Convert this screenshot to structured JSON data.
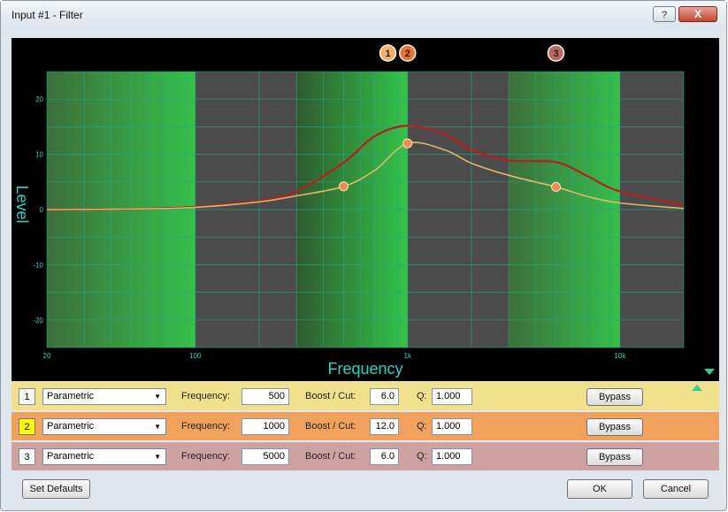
{
  "window": {
    "title": "Input #1 - Filter",
    "help_glyph": "?",
    "close_glyph": "X"
  },
  "graph": {
    "y_label": "Level",
    "x_label": "Frequency",
    "y_ticks": [
      "20",
      "10",
      "0",
      "-10",
      "-20"
    ],
    "x_ticks": [
      "20",
      "100",
      "1k",
      "10k"
    ],
    "markers": [
      "1",
      "2",
      "3"
    ],
    "colors": {
      "band1": "#f5b06f",
      "band2": "#e8733f",
      "band3": "#b46a6a",
      "combined": "#b52020",
      "single": "#e2b765",
      "grid": "#1fa98b",
      "axis_text": "#2dd3c3"
    }
  },
  "chart_data": {
    "type": "line",
    "x_scale": "log",
    "xlim": [
      20,
      20000
    ],
    "ylim": [
      -25,
      25
    ],
    "xlabel": "Frequency",
    "ylabel": "Level",
    "series": [
      {
        "x": [
          20,
          50,
          100,
          200,
          300,
          500,
          700,
          1000,
          1500,
          2000,
          3000,
          5000,
          7000,
          10000,
          20000
        ],
        "values": [
          0,
          0.1,
          0.5,
          1.6,
          3.3,
          8.5,
          13.3,
          15.2,
          13.6,
          10.8,
          8.9,
          8.6,
          6.1,
          3.3,
          0.8
        ]
      },
      {
        "x": [
          20,
          50,
          100,
          200,
          300,
          500,
          700,
          1000,
          1500,
          2000,
          3000,
          5000,
          7000,
          10000,
          20000
        ],
        "values": [
          0,
          0.1,
          0.4,
          1.4,
          2.5,
          4.2,
          7.1,
          12.0,
          10.8,
          8.4,
          6.2,
          4.1,
          2.4,
          1.2,
          0.2
        ]
      }
    ],
    "points": [
      {
        "label": "1",
        "x": 500,
        "y": 4.2
      },
      {
        "label": "2",
        "x": 1000,
        "y": 12.0
      },
      {
        "label": "3",
        "x": 5000,
        "y": 4.1
      }
    ]
  },
  "bands": [
    {
      "number": "1",
      "type": "Parametric",
      "freq_label": "Frequency:",
      "frequency": "500",
      "gain_label": "Boost / Cut:",
      "gain": "6.0",
      "q_label": "Q:",
      "q": "1.000",
      "bypass": "Bypass",
      "color": "#f1e18c",
      "active": false
    },
    {
      "number": "2",
      "type": "Parametric",
      "freq_label": "Frequency:",
      "frequency": "1000",
      "gain_label": "Boost / Cut:",
      "gain": "12.0",
      "q_label": "Q:",
      "q": "1.000",
      "bypass": "Bypass",
      "color": "#f0a25c",
      "active": true
    },
    {
      "number": "3",
      "type": "Parametric",
      "freq_label": "Frequency:",
      "frequency": "5000",
      "gain_label": "Boost / Cut:",
      "gain": "6.0",
      "q_label": "Q:",
      "q": "1.000",
      "bypass": "Bypass",
      "color": "#cfa2a2",
      "active": false
    }
  ],
  "footer": {
    "defaults": "Set Defaults",
    "ok": "OK",
    "cancel": "Cancel"
  }
}
